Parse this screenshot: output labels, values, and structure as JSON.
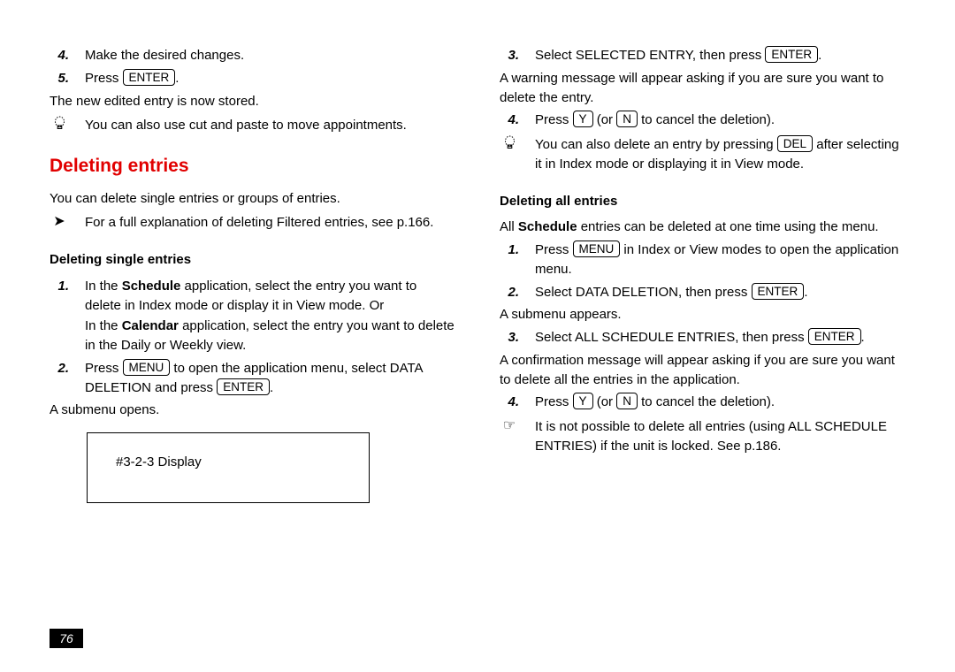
{
  "left": {
    "step4": "Make the desired changes.",
    "step5a": "Press ",
    "key_enter": "ENTER",
    "step5b": ".",
    "stored": "The new edited entry is now stored.",
    "tip1": "You can also use cut and paste to move appointments.",
    "heading": "Deleting entries",
    "intro": "You can delete single entries or groups of entries.",
    "xref": "For a full explanation of deleting Filtered entries, see p.166.",
    "sub": "Deleting single entries",
    "s1a": "In the ",
    "s1_sched": "Schedule",
    "s1b": " application, select the entry you want to delete in Index mode or display it in View mode. Or",
    "s1c": "In the ",
    "s1_cal": "Calendar",
    "s1d": " application, select the entry you want to delete in the Daily or Weekly view.",
    "s2a": "Press ",
    "key_menu": "MENU",
    "s2b": " to open the application menu, select DATA DELETION and press ",
    "s2c": ".",
    "submenu_opens": "A submenu opens.",
    "display": "#3-2-3 Display"
  },
  "right": {
    "s3a": "Select SELECTED ENTRY, then press ",
    "key_enter": "ENTER",
    "s3b": ".",
    "warn": "A warning message will appear asking if you are sure you want to delete the entry.",
    "s4a": "Press ",
    "key_y": "Y",
    "s4b": " (or ",
    "key_n": "N",
    "s4c": " to cancel the deletion).",
    "tip_a": "You can also delete an entry by pressing ",
    "key_del": "DEL",
    "tip_b": " after selecting it in Index mode or displaying it in View mode.",
    "sub": "Deleting all entries",
    "all_a": "All ",
    "all_sched": "Schedule",
    "all_b": " entries can be deleted at one time using the menu.",
    "b1a": "Press ",
    "key_menu": "MENU",
    "b1b": " in Index or View modes to open the application menu.",
    "b2a": "Select DATA DELETION, then press ",
    "b2b": ".",
    "submenu": "A submenu appears.",
    "b3a": "Select ALL SCHEDULE ENTRIES, then press ",
    "b3b": ".",
    "confirm": "A confirmation message will appear asking if you are sure you want to delete all the entries in the application.",
    "b4a": "Press ",
    "b4b": " (or ",
    "b4c": " to cancel the deletion).",
    "note": "It is not possible to delete all entries (using ALL SCHEDULE ENTRIES) if the unit is locked. See p.186."
  },
  "pagenum": "76"
}
